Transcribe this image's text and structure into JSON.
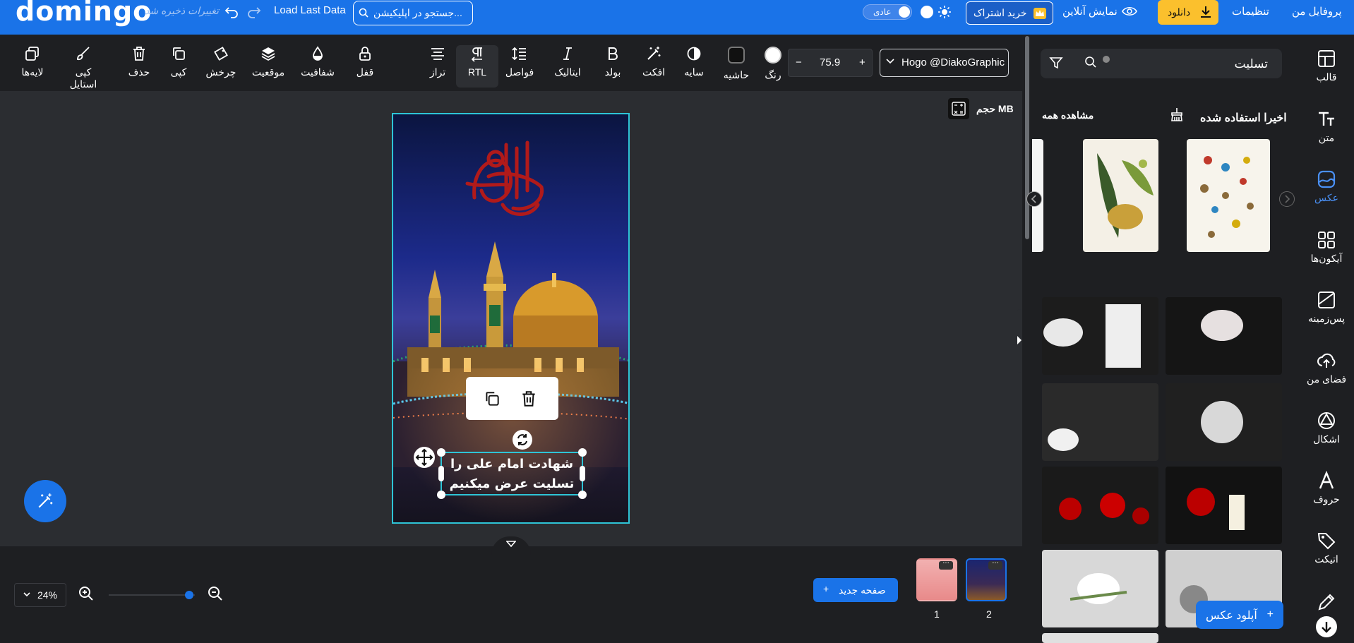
{
  "header": {
    "logo": "domingo",
    "unsaved": "تغییرات ذخیره شد",
    "load_last": "Load Last Data",
    "search_placeholder": "جستجو در اپلیکیشن...",
    "theme_label": "عادی",
    "subscribe": "خرید اشتراک",
    "preview": "نمایش آنلاین",
    "settings": "تنظیمات",
    "download": "دانلود",
    "profile": "پروفایل من",
    "brand_color": "#1a73e8",
    "download_color": "#fbc02d"
  },
  "toolbar": {
    "layers": "لایه‌ها",
    "copy_style": "کپی استایل",
    "delete": "حذف",
    "copy": "کپی",
    "rotate": "چرخش",
    "position": "موقعیت",
    "opacity": "شفافیت",
    "lock": "قفل",
    "align": "تراز",
    "rtl": "RTL",
    "spacing": "فواصل",
    "italic": "ایتالیک",
    "bold": "بولد",
    "effect": "افکت",
    "shadow": "سایه",
    "border": "حاشیه",
    "color": "رنگ",
    "font_size": "75.9",
    "font_name": "Hogo @DiakoGraphic",
    "border_color": "#111111",
    "text_color": "#ffffff"
  },
  "canvas": {
    "size_label": "حجم MB",
    "text_line1": "شهادت امام علی را",
    "text_line2": "تسلیت عرض میکنیم"
  },
  "bottom": {
    "zoom": "24%",
    "new_page": "صفحه جدید",
    "pages": [
      "1",
      "2"
    ]
  },
  "panel": {
    "search_value": "تسلیت",
    "recent_title": "اخیرا استفاده شده",
    "see_all": "مشاهده همه",
    "upload": "آپلود عکس"
  },
  "rail": {
    "items": [
      "قالب",
      "متن",
      "عکس",
      "آیکون‌ها",
      "پس‌زمینه",
      "فضای من",
      "اشکال",
      "حروف",
      "اتیکت"
    ]
  }
}
